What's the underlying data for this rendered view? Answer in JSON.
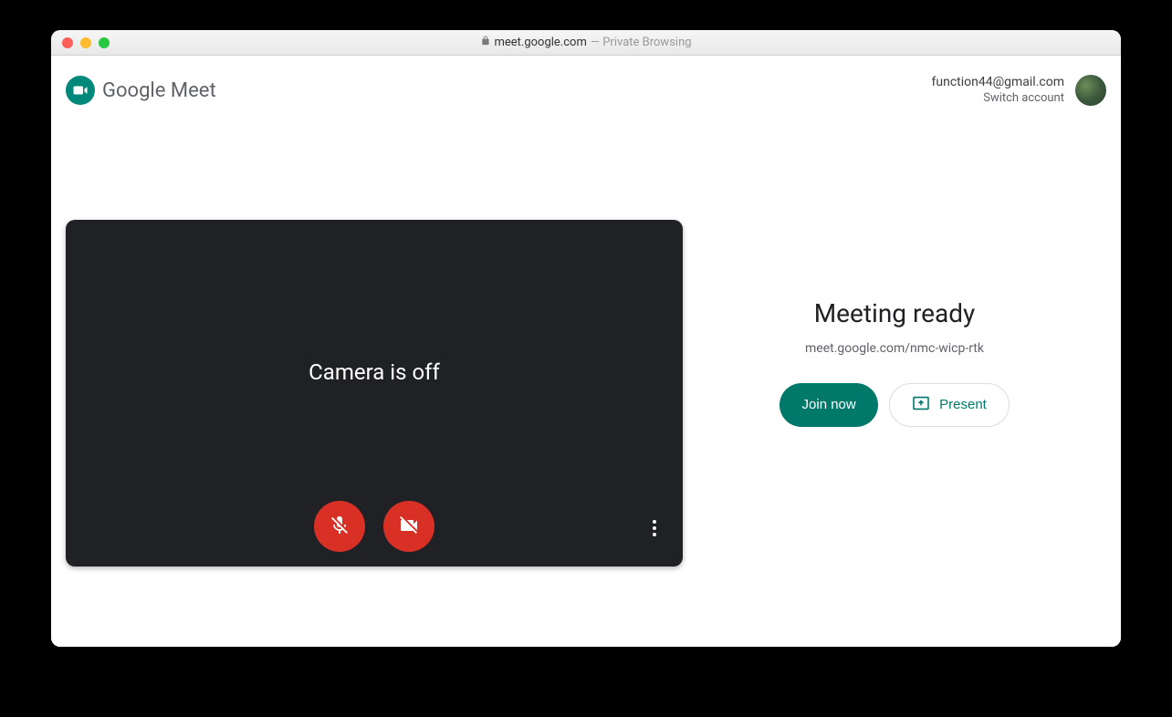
{
  "browser": {
    "domain": "meet.google.com",
    "suffix": " — Private Browsing"
  },
  "header": {
    "logo_brand": "Google ",
    "logo_product": "Meet",
    "account_email": "function44@gmail.com",
    "switch_account": "Switch account"
  },
  "preview": {
    "camera_off_text": "Camera is off"
  },
  "meeting": {
    "title": "Meeting ready",
    "url": "meet.google.com/nmc-wicp-rtk",
    "join_label": "Join now",
    "present_label": "Present"
  },
  "colors": {
    "accent": "#00796b",
    "danger": "#d93025",
    "video_bg": "#202124"
  }
}
